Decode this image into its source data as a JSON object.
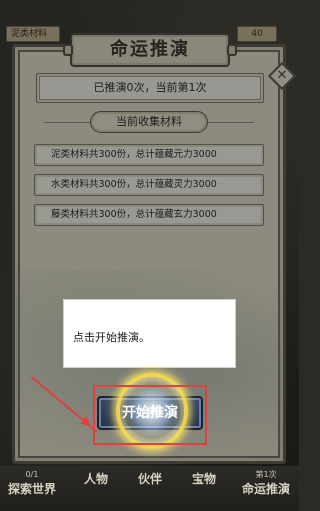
{
  "header": {
    "left_tag": "泥类材料",
    "right_count": "40"
  },
  "panel": {
    "title": "命运推演",
    "close_symbol": "✕",
    "status": "已推演0次，当前第1次",
    "section_title": "当前收集材料",
    "materials": [
      "泥类材料共300份，总计蕴藏元力3000",
      "水类材料共300份，总计蕴藏灵力3000",
      "藤类材料共300份，总计蕴藏玄力3000"
    ]
  },
  "tutorial": {
    "tip": "点击开始推演。",
    "start_button": "开始推演"
  },
  "bottom_nav": [
    {
      "count": "0/1",
      "label": "探索世界"
    },
    {
      "count": "",
      "label": "人物"
    },
    {
      "count": "",
      "label": "伙伴"
    },
    {
      "count": "",
      "label": "宝物"
    },
    {
      "count": "第1次",
      "label": "命运推演"
    }
  ],
  "colors": {
    "panel_bg": "#d9d5c3",
    "highlight_red": "#e0413f",
    "glow_gold": "#f5dc50"
  }
}
